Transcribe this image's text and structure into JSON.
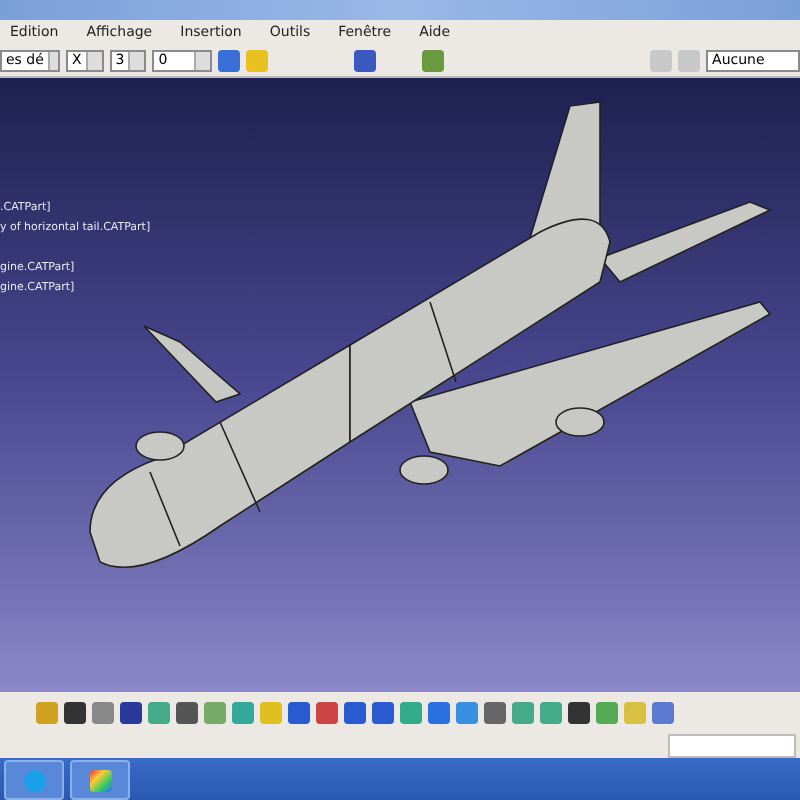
{
  "menu_bar": {
    "items": [
      "Edition",
      "Affichage",
      "Insertion",
      "Outils",
      "Fenêtre",
      "Aide"
    ]
  },
  "toolbar": {
    "style_dropdown": "es dé",
    "dropdown_2": "X",
    "dropdown_3": "3",
    "dropdown_4": "0",
    "layer_field": "Aucune"
  },
  "tree": {
    "items": [
      ".CATPart]",
      "y of horizontal tail.CATPart]",
      "gine.CATPart]",
      "gine.CATPart]"
    ]
  },
  "viewport": {
    "kind": "model"
  }
}
